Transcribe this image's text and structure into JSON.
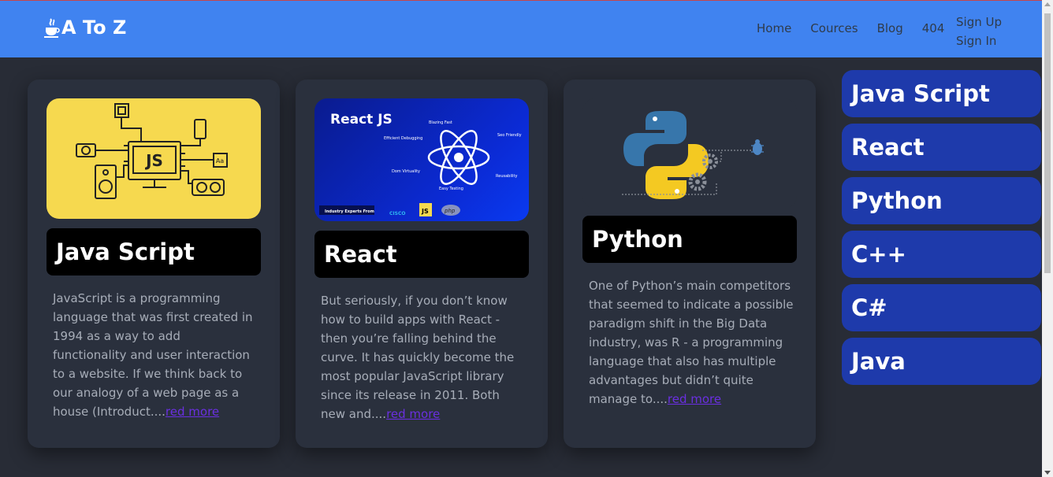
{
  "navbar": {
    "brand": "A To Z",
    "links": [
      "Home",
      "Cources",
      "Blog",
      "404"
    ],
    "auth": [
      "Sign Up",
      "Sign In"
    ]
  },
  "cards": [
    {
      "title": "Java Script",
      "image_text": "JS",
      "text": "JavaScript is a programming language that was first created in 1994 as a way to add functionality and user interaction to a website. If we think back to our analogy of a web page as a house (Introduct....",
      "link": "red more"
    },
    {
      "title": "React",
      "image_text": "React JS",
      "text": "But seriously, if you don’t know how to build apps with React - then you’re falling behind the curve. It has quickly become the most popular JavaScript library since its release in 2011. Both new and....",
      "link": "red more"
    },
    {
      "title": "Python",
      "text": "One of Python’s main competitors that seemed to indicate a possible paradigm shift in the Big Data industry, was R - a programming language that also has multiple advantages but didn’t quite manage to....",
      "link": "red more"
    }
  ],
  "react_image_labels": {
    "blazing_fast": "Blazing Fast",
    "efficient_debugging": "Efficient Debugging",
    "seo_friendly": "Seo Friendly",
    "dom_virtuality": "Dom Virtuality",
    "reusability": "Reusability",
    "easy_testing": "Easy Testing",
    "industry_experts": "Industry Experts From",
    "cisco": "CISCO",
    "js": "JS",
    "php": "php"
  },
  "sidebar": [
    "Java Script",
    "React",
    "Python",
    "C++",
    "C#",
    "Java"
  ],
  "colors": {
    "navbar": "#4083f0",
    "background": "#282c36",
    "card": "#2a303d",
    "sidebar_item": "#1e3aab",
    "link": "#6a2fe0"
  }
}
